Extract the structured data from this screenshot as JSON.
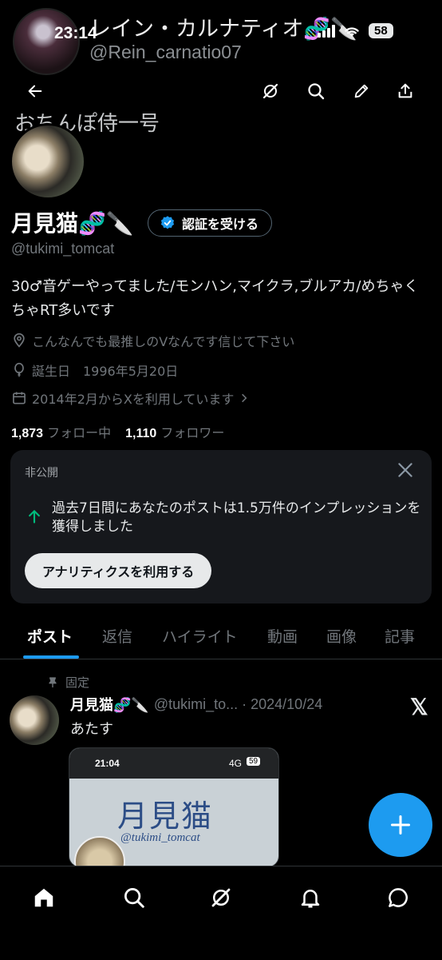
{
  "ghost_header": {
    "name": "レイン・カルナティオ🧬🔪",
    "handle": "@Rein_carnatio07"
  },
  "status_bar": {
    "time": "23:14",
    "battery": "58"
  },
  "nav": {
    "back_icon": "back-arrow-icon",
    "grok_icon": "grok-icon",
    "search_icon": "search-icon",
    "compose_icon": "pen-icon",
    "share_icon": "share-icon"
  },
  "profile": {
    "banner_text": "おちんぽ侍一号",
    "display_name": "月見猫🧬🔪",
    "verify_label": "認証を受ける",
    "handle": "@tukimi_tomcat",
    "bio": "30♂音ゲーやってました/モンハン,マイクラ,ブルアカ/めちゃくちゃRT多いです",
    "location": "こんなんでも最推しのVなんです信じて下さい",
    "birthday": "誕生日　1996年5月20日",
    "joined": "2014年2月からXを利用しています",
    "following_count": "1,873",
    "following_label": "フォロー中",
    "followers_count": "1,110",
    "followers_label": "フォロワー"
  },
  "analytics_card": {
    "title": "非公開",
    "message": "過去7日間にあなたのポストは1.5万件のインプレッションを獲得しました",
    "button_label": "アナリティクスを利用する",
    "accent_color": "#00ba7c"
  },
  "tabs": [
    "ポスト",
    "返信",
    "ハイライト",
    "動画",
    "画像",
    "記事"
  ],
  "pinned_post": {
    "pinned_label": "固定",
    "name": "月見猫🧬🔪",
    "handle_date": "@tukimi_to... · 2024/10/24",
    "text": "あたす",
    "media": {
      "time": "21:04",
      "network": "4G",
      "battery": "59",
      "title": "月見猫",
      "subtitle": "@tukimi_tomcat"
    }
  },
  "bottom_nav": [
    "home-icon",
    "search-icon",
    "grok-icon",
    "notifications-icon",
    "messages-icon"
  ],
  "colors": {
    "accent": "#1d9bf0",
    "background": "#000000",
    "card": "#16181c"
  }
}
